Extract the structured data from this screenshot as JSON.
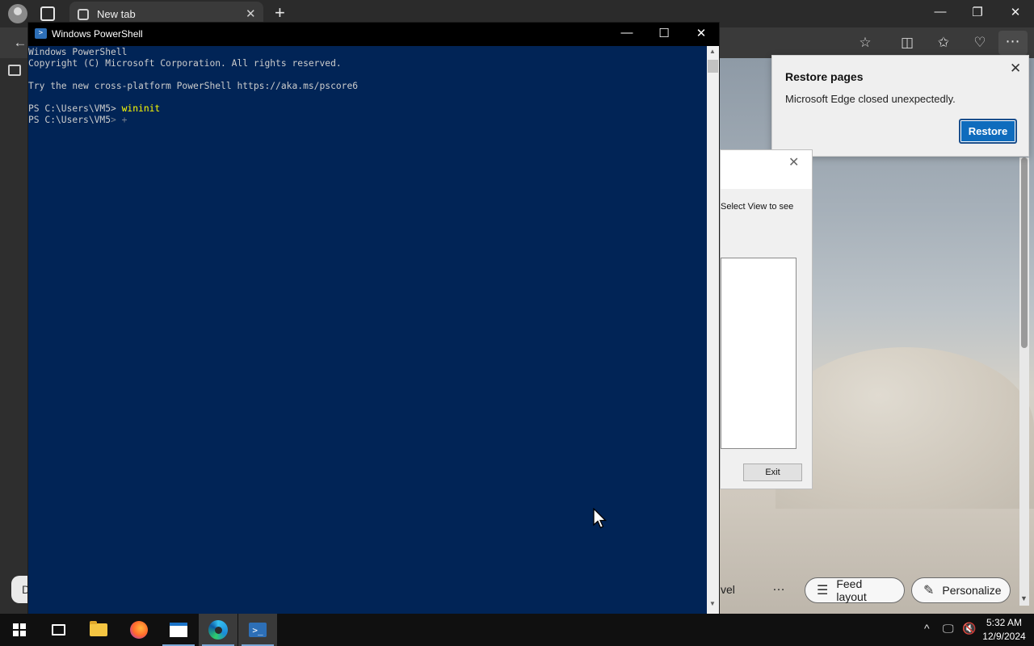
{
  "edge": {
    "tab_title": "New tab",
    "restore_popup": {
      "title": "Restore pages",
      "message": "Microsoft Edge closed unexpectedly.",
      "button": "Restore"
    },
    "pills": {
      "feed_layout": "Feed layout",
      "personalize": "Personalize"
    },
    "fragment_left": "D",
    "fragment_right": "vel",
    "more_dots": "…"
  },
  "dialog": {
    "hint": "Select View to see",
    "exit_label": "Exit"
  },
  "powershell": {
    "window_title": "Windows PowerShell",
    "lines": [
      "Windows PowerShell",
      "Copyright (C) Microsoft Corporation. All rights reserved.",
      "",
      "Try the new cross-platform PowerShell https://aka.ms/pscore6",
      ""
    ],
    "prompt": "PS C:\\Users\\VM5> ",
    "command": "wininit",
    "prompt2": "PS C:\\Users\\VM5",
    "prompt2_tail": "> +"
  },
  "taskbar": {
    "time": "5:32 AM",
    "date": "12/9/2024"
  },
  "colors": {
    "ps_background": "#012456",
    "ps_command": "#ffff00",
    "restore_button": "#0f6cbd"
  }
}
